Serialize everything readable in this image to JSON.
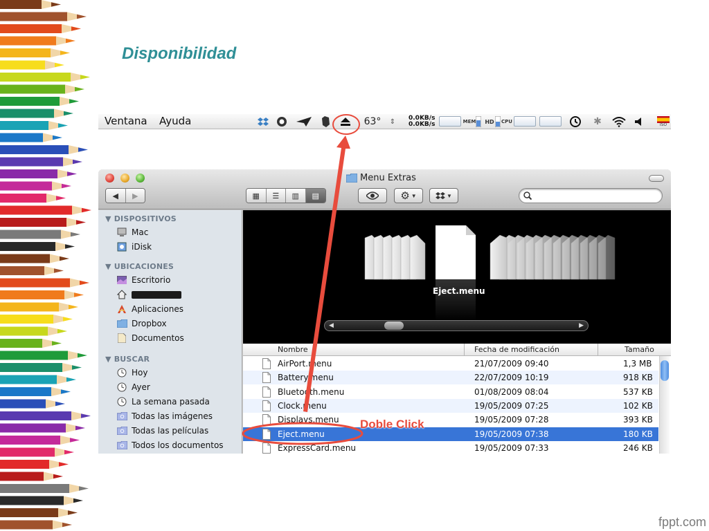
{
  "slide": {
    "title": "Disponibilidad",
    "watermark": "fppt.com"
  },
  "menubar": {
    "items": [
      "Ventana",
      "Ayuda"
    ],
    "temperature": "63°",
    "net_up": "0.0KB/s",
    "net_down": "0.0KB/s",
    "mem_label": "MEM",
    "hd_label": "HD",
    "cpu_label": "CPU",
    "flag_label": "ISO",
    "tray_icons": [
      "dropbox-icon",
      "app-icon",
      "plane-icon",
      "evernote-icon",
      "eject-icon",
      "time-machine-icon",
      "bluetooth-icon",
      "wifi-icon",
      "volume-icon",
      "flag-icon"
    ]
  },
  "finder": {
    "title": "Menu Extras",
    "search_placeholder": "",
    "sidebar": {
      "sections": [
        {
          "header": "DISPOSITIVOS",
          "items": [
            {
              "label": "Mac",
              "icon": "computer-icon"
            },
            {
              "label": "iDisk",
              "icon": "idisk-icon"
            }
          ]
        },
        {
          "header": "UBICACIONES",
          "items": [
            {
              "label": "Escritorio",
              "icon": "desktop-icon"
            },
            {
              "label": "",
              "icon": "home-icon",
              "redacted": true
            },
            {
              "label": "Aplicaciones",
              "icon": "applications-icon"
            },
            {
              "label": "Dropbox",
              "icon": "folder-icon"
            },
            {
              "label": "Documentos",
              "icon": "documents-icon"
            }
          ]
        },
        {
          "header": "BUSCAR",
          "items": [
            {
              "label": "Hoy",
              "icon": "clock-icon"
            },
            {
              "label": "Ayer",
              "icon": "clock-icon"
            },
            {
              "label": "La semana pasada",
              "icon": "clock-icon"
            },
            {
              "label": "Todas las imágenes",
              "icon": "smart-folder-icon"
            },
            {
              "label": "Todas las películas",
              "icon": "smart-folder-icon"
            },
            {
              "label": "Todos los documentos",
              "icon": "smart-folder-icon"
            }
          ]
        }
      ]
    },
    "coverflow_label": "Eject.menu",
    "columns": {
      "name": "Nombre",
      "date": "Fecha de modificación",
      "size": "Tamaño"
    },
    "files": [
      {
        "name": "AirPort.menu",
        "date": "21/07/2009 09:40",
        "size": "1,3 MB"
      },
      {
        "name": "Battery.menu",
        "date": "22/07/2009 10:19",
        "size": "918 KB"
      },
      {
        "name": "Bluetooth.menu",
        "date": "01/08/2009 08:04",
        "size": "537 KB"
      },
      {
        "name": "Clock.menu",
        "date": "19/05/2009 07:25",
        "size": "102 KB"
      },
      {
        "name": "Displays.menu",
        "date": "19/05/2009 07:28",
        "size": "393 KB"
      },
      {
        "name": "Eject.menu",
        "date": "19/05/2009 07:38",
        "size": "180 KB",
        "selected": true
      },
      {
        "name": "ExpressCard.menu",
        "date": "19/05/2009 07:33",
        "size": "246 KB"
      }
    ]
  },
  "annotation": {
    "label": "Doble Click",
    "color": "#e84c3d"
  }
}
